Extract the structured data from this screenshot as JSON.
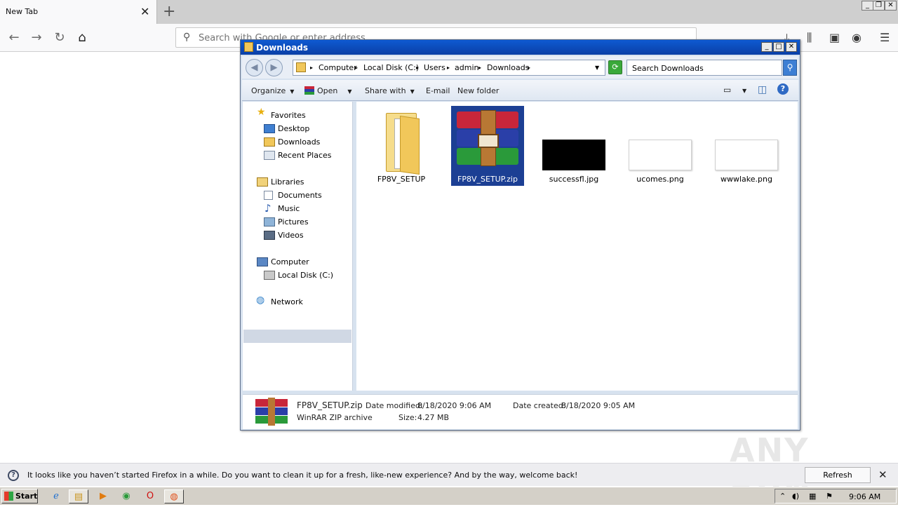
{
  "firefox": {
    "tab_title": "New Tab",
    "tab_close": "✕",
    "new_tab": "+",
    "url_placeholder": "Search with Google or enter address",
    "window_controls": [
      "_",
      "❐",
      "✕"
    ]
  },
  "explorer": {
    "title": "Downloads",
    "breadcrumb": [
      "Computer",
      "Local Disk (C:)",
      "Users",
      "admin",
      "Downloads"
    ],
    "search_placeholder": "Search Downloads",
    "commands": {
      "organize": "Organize",
      "open": "Open",
      "share_with": "Share with",
      "email": "E-mail",
      "new_folder": "New folder"
    },
    "nav": {
      "favorites": "Favorites",
      "desktop": "Desktop",
      "downloads": "Downloads",
      "recent_places": "Recent Places",
      "libraries": "Libraries",
      "documents": "Documents",
      "music": "Music",
      "pictures": "Pictures",
      "videos": "Videos",
      "computer": "Computer",
      "local_disk": "Local Disk (C:)",
      "network": "Network"
    },
    "files": [
      {
        "name": "FP8V_SETUP",
        "type": "folder"
      },
      {
        "name": "FP8V_SETUP.zip",
        "type": "winrar-archive",
        "selected": true
      },
      {
        "name": "successfl.jpg",
        "type": "image"
      },
      {
        "name": "ucomes.png",
        "type": "image"
      },
      {
        "name": "wwwlake.png",
        "type": "image"
      }
    ],
    "details": {
      "name": "FP8V_SETUP.zip",
      "type": "WinRAR ZIP archive",
      "date_modified_label": "Date modified:",
      "date_modified": "8/18/2020 9:06 AM",
      "size_label": "Size:",
      "size": "4.27 MB",
      "date_created_label": "Date created:",
      "date_created": "8/18/2020 9:05 AM"
    }
  },
  "notification": {
    "message": "It looks like you haven’t started Firefox in a while. Do you want to clean it up for a fresh, like-new experience? And by the way, welcome back!",
    "button": "Refresh Firefox…",
    "close": "✕"
  },
  "taskbar": {
    "start": "Start",
    "clock": "9:06 AM"
  },
  "watermark": "ANY RUN",
  "colors": {
    "explorer_title": "#0a3fa6",
    "selection": "#1c3f94",
    "winrar_red": "#c8263a",
    "winrar_blue": "#2a3fa8",
    "winrar_green": "#2a9a3a"
  }
}
